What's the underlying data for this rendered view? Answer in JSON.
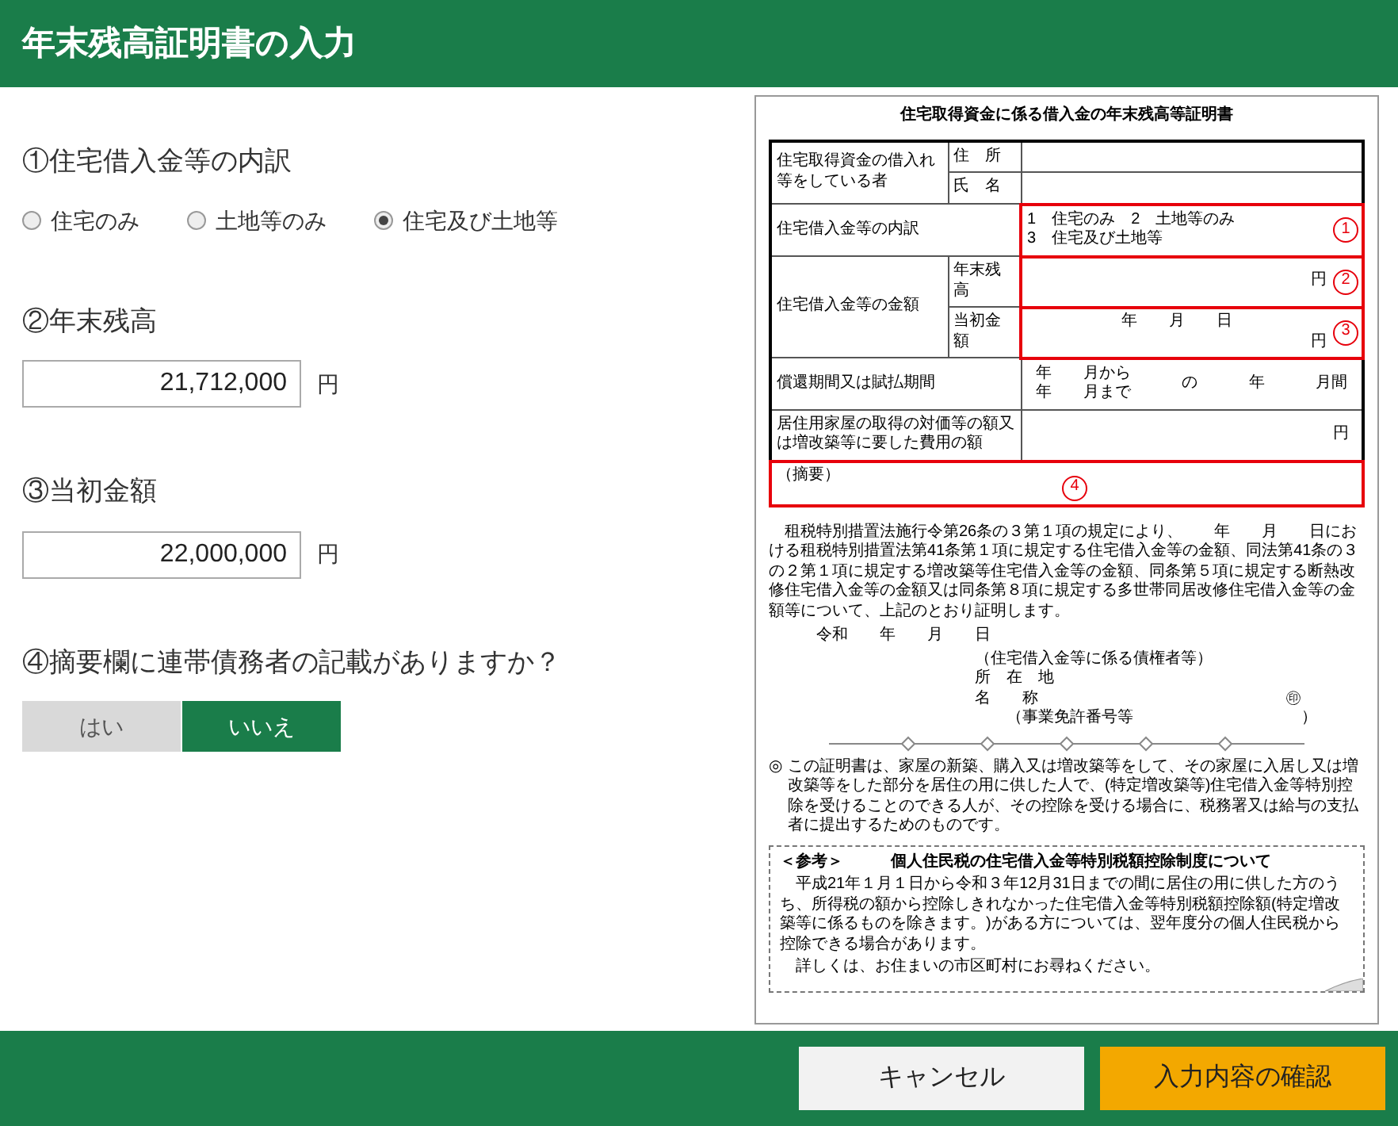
{
  "header": {
    "title": "年末残高証明書の入力"
  },
  "questions": [
    {
      "kind": "radio",
      "label": "①住宅借入金等の内訳",
      "options": [
        {
          "label": "住宅のみ",
          "selected": false
        },
        {
          "label": "土地等のみ",
          "selected": false
        },
        {
          "label": "住宅及び土地等",
          "selected": true
        }
      ]
    },
    {
      "kind": "amount",
      "label": "②年末残高",
      "value": "21,712,000",
      "unit": "円"
    },
    {
      "kind": "amount",
      "label": "③当初金額",
      "value": "22,000,000",
      "unit": "円"
    },
    {
      "kind": "toggle",
      "label": "④摘要欄に連帯債務者の記載がありますか？",
      "options": [
        {
          "label": "はい",
          "selected": false
        },
        {
          "label": "いいえ",
          "selected": true
        }
      ]
    }
  ],
  "document": {
    "title": "住宅取得資金に係る借入金の年末残高等証明書",
    "borrower": {
      "label": "住宅取得資金の借入れ等をしている者",
      "address_label": "住　所",
      "name_label": "氏　名"
    },
    "breakdown": {
      "label": "住宅借入金等の内訳",
      "options": [
        "1　住宅のみ",
        "2　土地等のみ",
        "3　住宅及び土地等"
      ],
      "marker": "1"
    },
    "amounts": {
      "label": "住宅借入金等の金額",
      "year_end": {
        "label": "年末残高",
        "unit": "円",
        "marker": "2"
      },
      "initial": {
        "label": "当初金額",
        "date": "年　　月　　日",
        "unit": "円",
        "marker": "3"
      }
    },
    "period": {
      "label": "償還期間又は賦払期間",
      "from": "年　　月から",
      "to": "年　　月まで",
      "middle": "の",
      "years": "年",
      "months": "月間"
    },
    "cost": {
      "label": "居住用家屋の取得の対価等の額又は増改築等に要した費用の額",
      "unit": "円"
    },
    "remarks": {
      "label": "（摘要）",
      "marker": "4"
    },
    "statement": "租税特別措置法施行令第26条の３第１項の規定により、　　年　　月　　日における租税特別措置法第41条第１項に規定する住宅借入金等の金額、同法第41条の３の２第１項に規定する増改築等住宅借入金等の金額、同条第５項に規定する断熱改修住宅借入金等の金額又は同条第８項に規定する多世帯同居改修住宅借入金等の金額等について、上記のとおり証明します。",
    "date_line": "令和　　年　　月　　日",
    "creditor": {
      "heading": "（住宅借入金等に係る債権者等）",
      "address_label": "所　在　地",
      "name_label": "名　　称",
      "seal": "㊞",
      "license": "（事業免許番号等",
      "license_close": "）"
    },
    "note": {
      "mark": "◎",
      "text": "この証明書は、家屋の新築、購入又は増改築等をして、その家屋に入居し又は増改築等をした部分を居住の用に供した人で、(特定増改築等)住宅借入金等特別控除を受けることのできる人が、その控除を受ける場合に、税務署又は給与の支払者に提出するためのものです。"
    },
    "reference": {
      "tag": "＜参考＞",
      "title": "個人住民税の住宅借入金等特別税額控除制度について",
      "paragraphs": [
        "平成21年１月１日から令和３年12月31日までの間に居住の用に供した方のうち、所得税の額から控除しきれなかった住宅借入金等特別税額控除額(特定増改築等に係るものを除きます。)がある方については、翌年度分の個人住民税から控除できる場合があります。",
        "詳しくは、お住まいの市区町村にお尋ねください。"
      ]
    }
  },
  "footer": {
    "buttons": [
      {
        "label": "キャンセル",
        "kind": "secondary"
      },
      {
        "label": "入力内容の確認",
        "kind": "primary"
      }
    ]
  }
}
